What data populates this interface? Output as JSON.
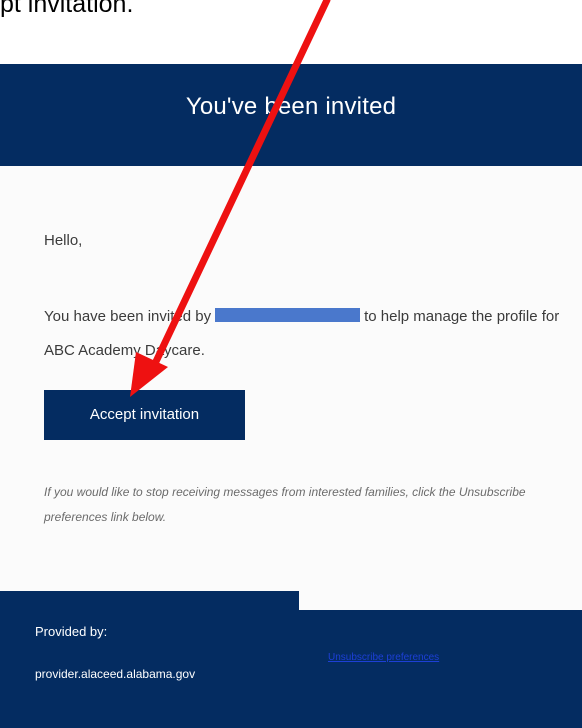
{
  "caption": "pt invitation.",
  "header": {
    "title": "You've been invited"
  },
  "body": {
    "greeting": "Hello,",
    "invite_text_before": "You have been invited by",
    "invite_text_after": "to help manage the profile for ABC Academy Daycare.",
    "accept_button_label": "Accept invitation",
    "unsubscribe_note": "If you would like to stop receiving messages from interested families, click the Unsubscribe preferences link below."
  },
  "footer": {
    "provided_by_label": "Provided by:",
    "provider_url": "provider.alaceed.alabama.gov",
    "unsubscribe_link": "Unsubscribe preferences"
  },
  "colors": {
    "brand_navy": "#042c61",
    "redaction_blue": "#4a78cc",
    "annotation_red": "#ee1111",
    "link_blue": "#1d3fd6"
  }
}
